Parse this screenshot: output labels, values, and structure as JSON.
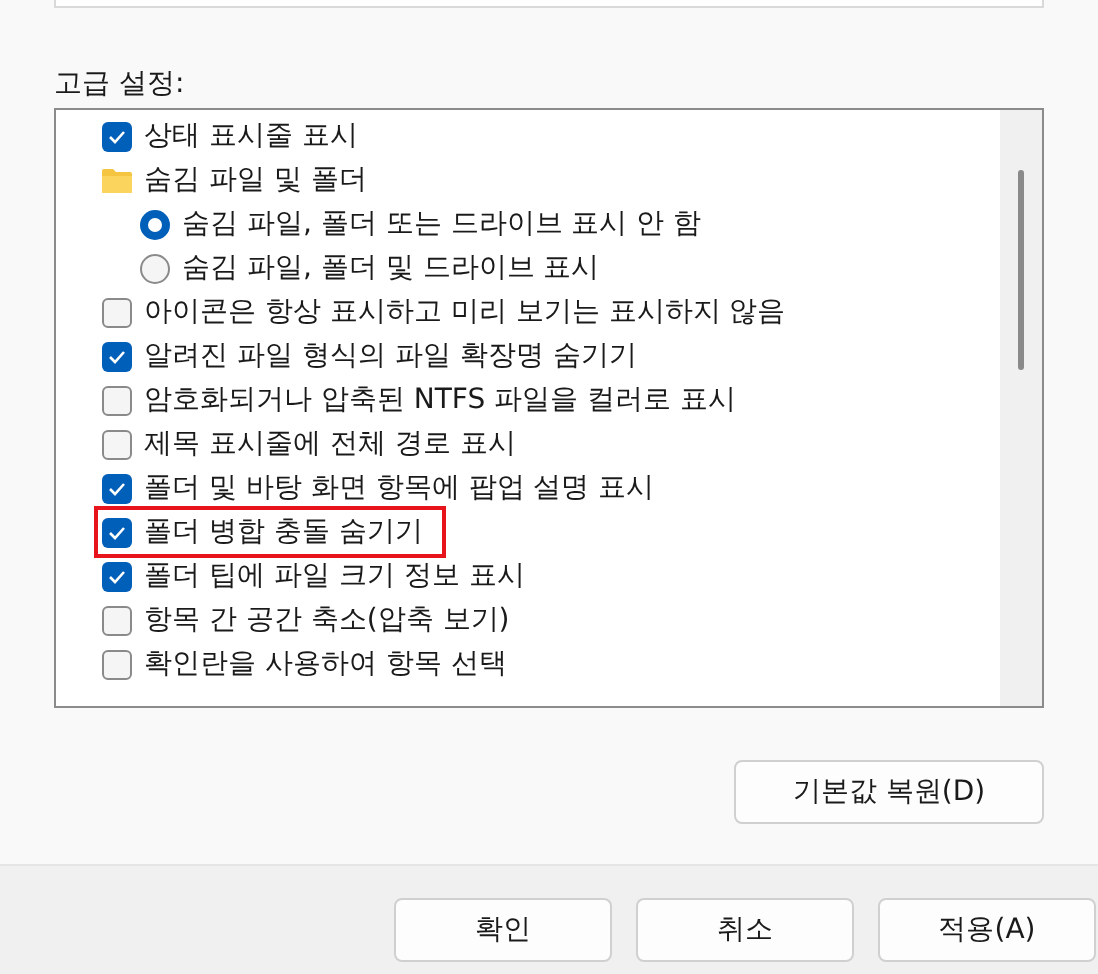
{
  "section_label": "고급 설정:",
  "items": [
    {
      "kind": "checkbox",
      "label": "상태 표시줄 표시",
      "checked": true,
      "highlighted": false
    },
    {
      "kind": "folder",
      "label": "숨김 파일 및 폴더",
      "children": [
        {
          "kind": "radio",
          "label": "숨김 파일, 폴더 또는 드라이브 표시 안 함",
          "selected": true
        },
        {
          "kind": "radio",
          "label": "숨김 파일, 폴더 및 드라이브 표시",
          "selected": false
        }
      ]
    },
    {
      "kind": "checkbox",
      "label": "아이콘은 항상 표시하고 미리 보기는 표시하지 않음",
      "checked": false,
      "highlighted": false
    },
    {
      "kind": "checkbox",
      "label": "알려진 파일 형식의 파일 확장명 숨기기",
      "checked": true,
      "highlighted": false
    },
    {
      "kind": "checkbox",
      "label": "암호화되거나 압축된 NTFS 파일을 컬러로 표시",
      "checked": false,
      "highlighted": false
    },
    {
      "kind": "checkbox",
      "label": "제목 표시줄에 전체 경로 표시",
      "checked": false,
      "highlighted": false
    },
    {
      "kind": "checkbox",
      "label": "폴더 및 바탕 화면 항목에 팝업 설명 표시",
      "checked": true,
      "highlighted": false
    },
    {
      "kind": "checkbox",
      "label": "폴더 병합 충돌 숨기기",
      "checked": true,
      "highlighted": true
    },
    {
      "kind": "checkbox",
      "label": "폴더 팁에 파일 크기 정보 표시",
      "checked": true,
      "highlighted": false
    },
    {
      "kind": "checkbox",
      "label": "항목 간 공간 축소(압축 보기)",
      "checked": false,
      "highlighted": false
    },
    {
      "kind": "checkbox",
      "label": "확인란을 사용하여 항목 선택",
      "checked": false,
      "highlighted": false
    }
  ],
  "restore_button": "기본값 복원(D)",
  "buttons": [
    "확인",
    "취소",
    "적용(A)"
  ]
}
